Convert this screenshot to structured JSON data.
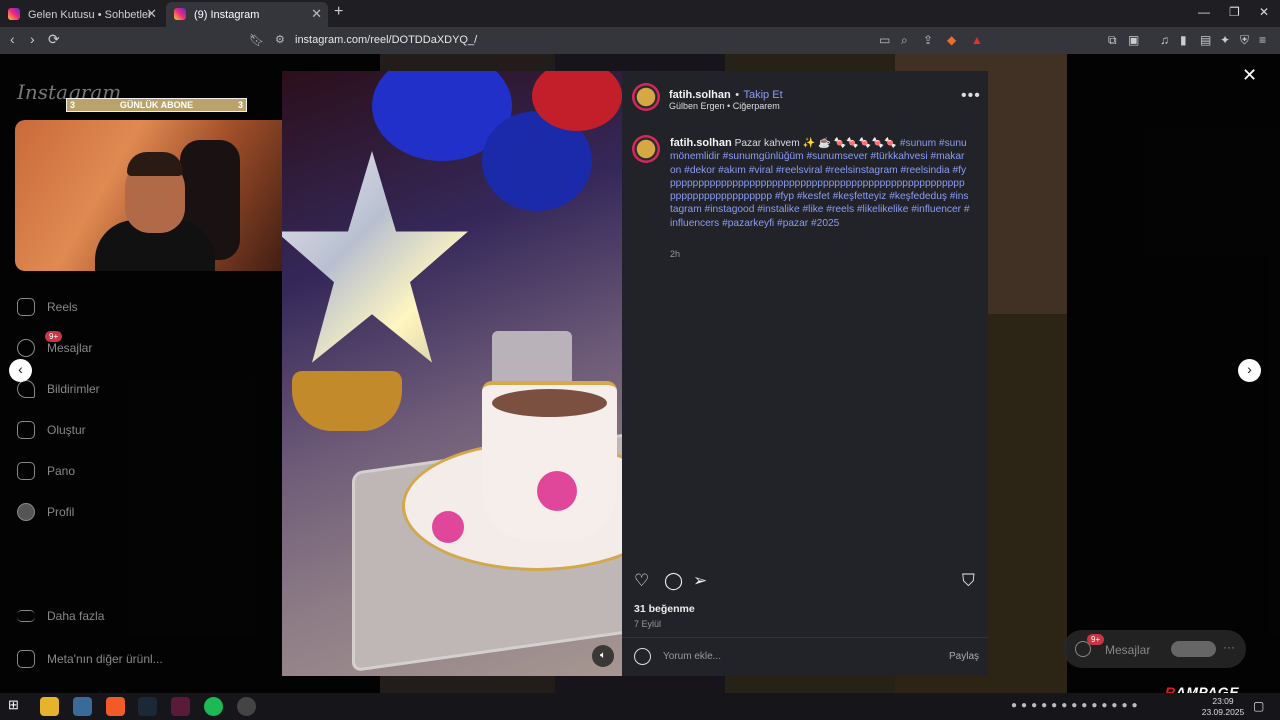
{
  "browser": {
    "tabs": [
      {
        "title": "Gelen Kutusu • Sohbetler"
      },
      {
        "title": "(9) Instagram"
      }
    ],
    "new_tab": "+",
    "url": "instagram.com/reel/DOTDDaXDYQ_/",
    "window_controls": {
      "minimize": "—",
      "restore": "❐",
      "close": "✕"
    }
  },
  "sidebar": {
    "logo": "Instagram",
    "items": [
      {
        "label": "Reels",
        "icon": "reels-icon"
      },
      {
        "label": "Mesajlar",
        "icon": "messenger-icon",
        "badge": "9+"
      },
      {
        "label": "Bildirimler",
        "icon": "heart-icon"
      },
      {
        "label": "Oluştur",
        "icon": "plus-icon"
      },
      {
        "label": "Pano",
        "icon": "chart-icon"
      },
      {
        "label": "Profil",
        "icon": "avatar-icon"
      },
      {
        "label": "Daha fazla",
        "icon": "menu-icon"
      },
      {
        "label": "Meta'nın diğer ürünl...",
        "icon": "grid-icon"
      }
    ]
  },
  "overlay_widget": {
    "label": "GÜNLÜK ABONE",
    "left_count": "3",
    "right_count": "3"
  },
  "post": {
    "username": "fatih.solhan",
    "separator": "•",
    "follow": "Takip Et",
    "audio": "Gülben Ergen • Ciğerparem",
    "more": "•••",
    "caption_user": "fatih.solhan",
    "caption_text": "Pazar kahvem ✨ ☕ 🍬🍬🍬🍬🍬",
    "hashtags": "#sunum #sunumönemlidir #sunumgünlüğüm #sunumsever #türkkahvesi #makaron #dekor #akım #viral #reelsviral #reelsinstagram #reelsindia #fypppppppppppppppppppppppppppppppppppppppppppppppppppppppppppppppppppppp #fyp #kesfet #keşfetteyiz #keşfededuş #instagram #instagood #instalike #like #reels #likelikelike #influencer #influencers #pazarkeyfi #pazar #2025",
    "time_ago": "2h",
    "likes": "31 beğenme",
    "date": "7 Eylül",
    "comment_placeholder": "Yorum ekle...",
    "share_label": "Paylaş"
  },
  "floating_messages": {
    "label": "Mesajlar",
    "badge": "9+",
    "more": "···"
  },
  "watermark": {
    "prefix": "R",
    "text": "AMPAGE"
  },
  "taskbar": {
    "time": "23:09",
    "date": "23.09.2025"
  },
  "colors": {
    "accent_link": "#8c9cf7",
    "panel_bg": "#212328",
    "badge_red": "#c93545"
  }
}
